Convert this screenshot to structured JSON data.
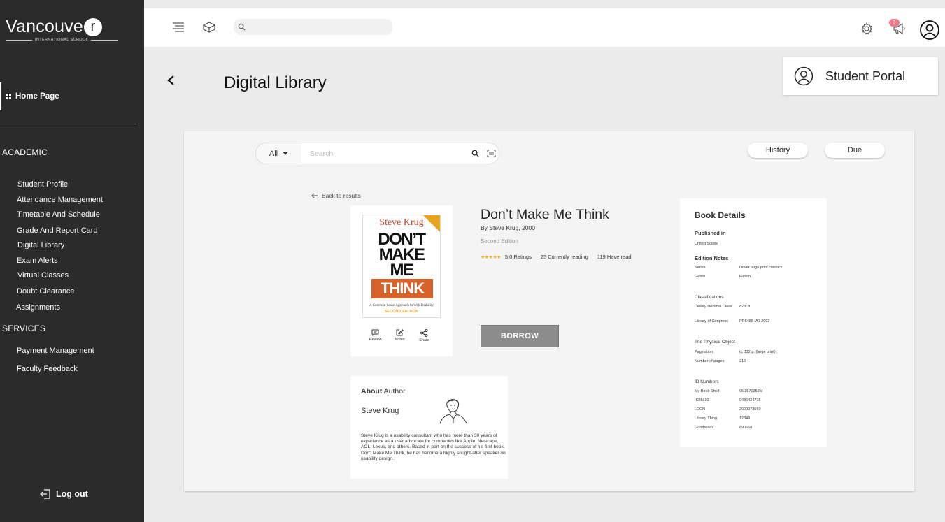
{
  "sidebar": {
    "logo_main": "Vancouve",
    "logo_r": "r",
    "logo_sub": "INTERNATIONAL SCHOOL",
    "home_label": "Home Page",
    "academic_heading": "ACADEMIC",
    "academic_items": [
      "Student Profile",
      "Attendance Management",
      "Timetable And Schedule",
      "Grade And Report Card",
      "Digital Library",
      "Exam Alerts",
      "Virtual Classes",
      "Doubt Clearance",
      "Assignments"
    ],
    "services_heading": "SERVICES",
    "services_items": [
      "Payment Management",
      "Faculty Feedback"
    ],
    "logout_label": "Log out"
  },
  "topbar": {
    "search_placeholder": "",
    "notification_count": "3"
  },
  "header": {
    "page_title": "Digital Library",
    "portal_label": "Student Portal"
  },
  "search": {
    "category": "All",
    "placeholder": "Search",
    "history_label": "History",
    "due_label": "Due"
  },
  "book": {
    "back_label": "Back to results",
    "title": "Don’t Make Me Think",
    "by_prefix": "By ",
    "author": "Steve Krug",
    "year": ", 2000",
    "edition": "Second Edition",
    "rating_stars": "★★★★★",
    "ratings": "5.0 Ratings",
    "currently_reading": "25 Currently reading",
    "have_read": "119 Have read",
    "borrow_label": "BORROW",
    "actions": [
      "Review",
      "Notes",
      "Share"
    ],
    "cover": {
      "author": "Steve Krug",
      "line1": "DON’T",
      "line2": "MAKE",
      "line3": "ME",
      "line4": "THINK",
      "tagline": "A Common Sense Approach to Web Usability",
      "edition": "SECOND EDITION"
    }
  },
  "details": {
    "heading": "Book Details",
    "published_label": "Published in",
    "published_value": "United States",
    "edition_notes_label": "Edition Notes",
    "series_key": "Series",
    "series_value": "Dover large print classics",
    "genre_key": "Genre",
    "genre_value": "Fiction.",
    "classifications_label": "Classifications",
    "dewey_key": "Dewey Decimal Class",
    "dewey_value": "823/.8",
    "loc_key": "Library of Congress",
    "loc_value": "PR5485 .A1 2002",
    "physical_label": "The Physical Object",
    "pagination_key": "Pagination",
    "pagination_value": "ix, 112 p. (large print) ;",
    "pages_key": "Number of pages",
    "pages_value": "216",
    "id_label": "ID Numbers",
    "ids": [
      {
        "k": "My Book Shelf",
        "v": "OL3570252M"
      },
      {
        "k": "ISBN 10",
        "v": "0486424715"
      },
      {
        "k": "LCCN",
        "v": "2002073560"
      },
      {
        "k": "Library Thing",
        "v": "12349"
      },
      {
        "k": "Goodreads",
        "v": "690668"
      }
    ]
  },
  "author_card": {
    "heading_about": "About",
    "heading_author": " Author",
    "name": "Steve Krug",
    "bio": "Steve Krug is a usability consultant who has more than 30 years of experience as a user advocate for companies like Apple, Netscape, AOL, Lexus, and others. Based in part on the success of his first book, Don't Make Me Think, he has become a highly sought-after speaker on usability design."
  },
  "colors": {
    "sidebar_bg": "#2b2b2b",
    "accent_orange": "#d9622b",
    "star_color": "#f2b01e",
    "badge_color": "#f07a8a",
    "borrow_bg": "#8c8c8c"
  }
}
